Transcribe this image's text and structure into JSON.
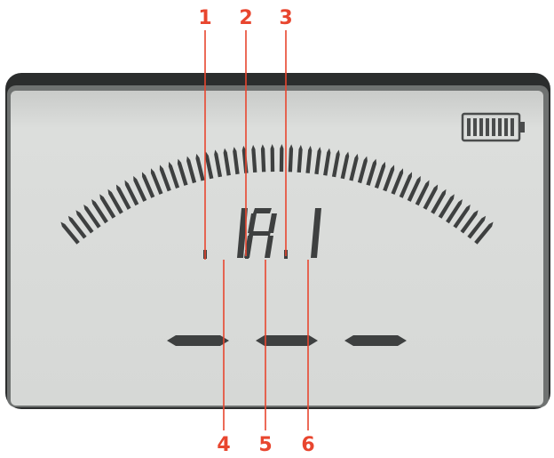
{
  "figure": {
    "callouts_top": [
      "1",
      "2",
      "3"
    ],
    "callouts_bottom": [
      "4",
      "5",
      "6"
    ],
    "display": {
      "digits": [
        "1",
        "A",
        "1"
      ],
      "battery_level": 1.0,
      "arc_segment_count": 50,
      "dash_count": 3
    },
    "colors": {
      "callout": "#e8462f",
      "lcd_background": "#d8dad8",
      "segment": "#3e4040",
      "bezel": "#2a2c2c"
    }
  }
}
